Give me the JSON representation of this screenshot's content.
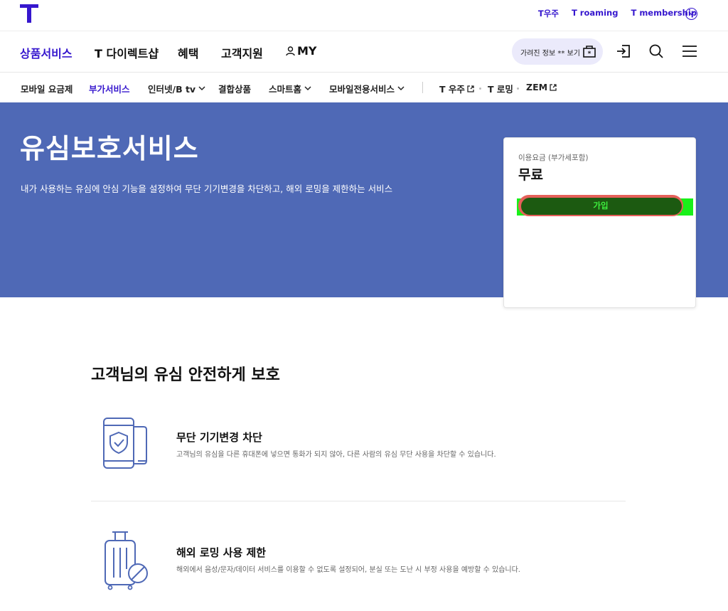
{
  "colors": {
    "brand": "#3617ce",
    "hero_bg": "#4f69b6",
    "privacy_bg": "#ebeafb"
  },
  "top_links": [
    "T우주",
    "T roaming",
    "T membership"
  ],
  "main_nav": {
    "items": [
      "상품서비스",
      "T 다이렉트샵",
      "혜택",
      "고객지원",
      "MY"
    ],
    "active": "상품서비스",
    "privacy_label": "가려진 정보 ** 보기"
  },
  "sub_nav": {
    "items": [
      "모바일 요금제",
      "부가서비스",
      "인터넷/B tv",
      "결합상품",
      "스마트홈",
      "모바일전용서비스"
    ],
    "active": "부가서비스",
    "external": [
      "T 우주",
      "T 로밍",
      "ZEM"
    ]
  },
  "hero": {
    "title": "유심보호서비스",
    "description": "내가 사용하는 유심에 안심 기능을 설정하여 무단 기기변경을 차단하고, 해외 로밍을 제한하는 서비스"
  },
  "price": {
    "label": "이용요금 (부가세포함)",
    "value": "무료",
    "join_label": "가입"
  },
  "content": {
    "section_title": "고객님의 유심 안전하게 보호",
    "features": [
      {
        "icon": "phone-shield-icon",
        "title": "무단 기기변경 차단",
        "description": "고객님의 유심을 다른 휴대폰에 넣으면 통화가 되지 않아, 다른 사람의 유심 무단 사용을 차단할 수 있습니다."
      },
      {
        "icon": "luggage-block-icon",
        "title": "해외 로밍 사용 제한",
        "description": "해외에서 음성/문자/데이터 서비스를 이용할 수 없도록 설정되어, 분실 또는 도난 시 부정 사용을 예방할 수 있습니다."
      }
    ]
  }
}
